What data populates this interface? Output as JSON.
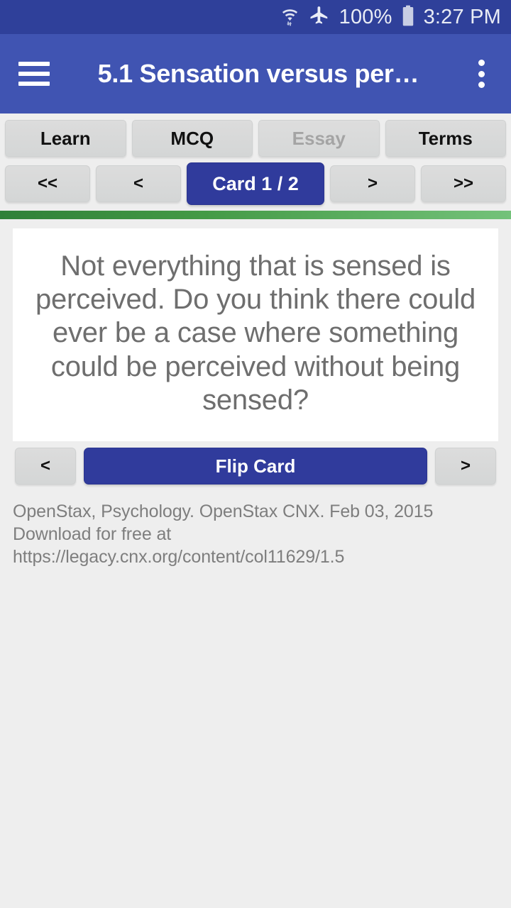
{
  "status_bar": {
    "wifi_icon": "wifi-with-transfer-arrows-icon",
    "airplane_icon": "airplane-mode-icon",
    "battery_percent": "100%",
    "battery_icon": "battery-full-icon",
    "time": "3:27 PM",
    "background_color": "#2f409a"
  },
  "app_bar": {
    "menu_icon": "hamburger-menu-icon",
    "title": "5.1 Sensation versus per…",
    "overflow_icon": "more-vertical-icon",
    "background_color": "#4054b2"
  },
  "tabs": [
    {
      "label": "Learn",
      "enabled": true
    },
    {
      "label": "MCQ",
      "enabled": true
    },
    {
      "label": "Essay",
      "enabled": false
    },
    {
      "label": "Terms",
      "enabled": true
    }
  ],
  "nav_row": {
    "first_label": "<<",
    "prev_label": "<",
    "counter_label": "Card 1 / 2",
    "next_label": ">",
    "last_label": ">>",
    "counter_color": "#303b9c"
  },
  "progress": {
    "gradient_start": "#2f8038",
    "gradient_end": "#74c27a",
    "percent": 100
  },
  "flashcard": {
    "text": "Not everything that is sensed is perceived. Do you think there could ever be a case where something could be perceived without being sensed?"
  },
  "flip_row": {
    "prev_label": "<",
    "flip_label": "Flip Card",
    "next_label": ">",
    "flip_color": "#303b9c"
  },
  "attribution": {
    "text": "OpenStax, Psychology. OpenStax CNX. Feb 03, 2015 Download for free at https://legacy.cnx.org/content/col11629/1.5"
  }
}
